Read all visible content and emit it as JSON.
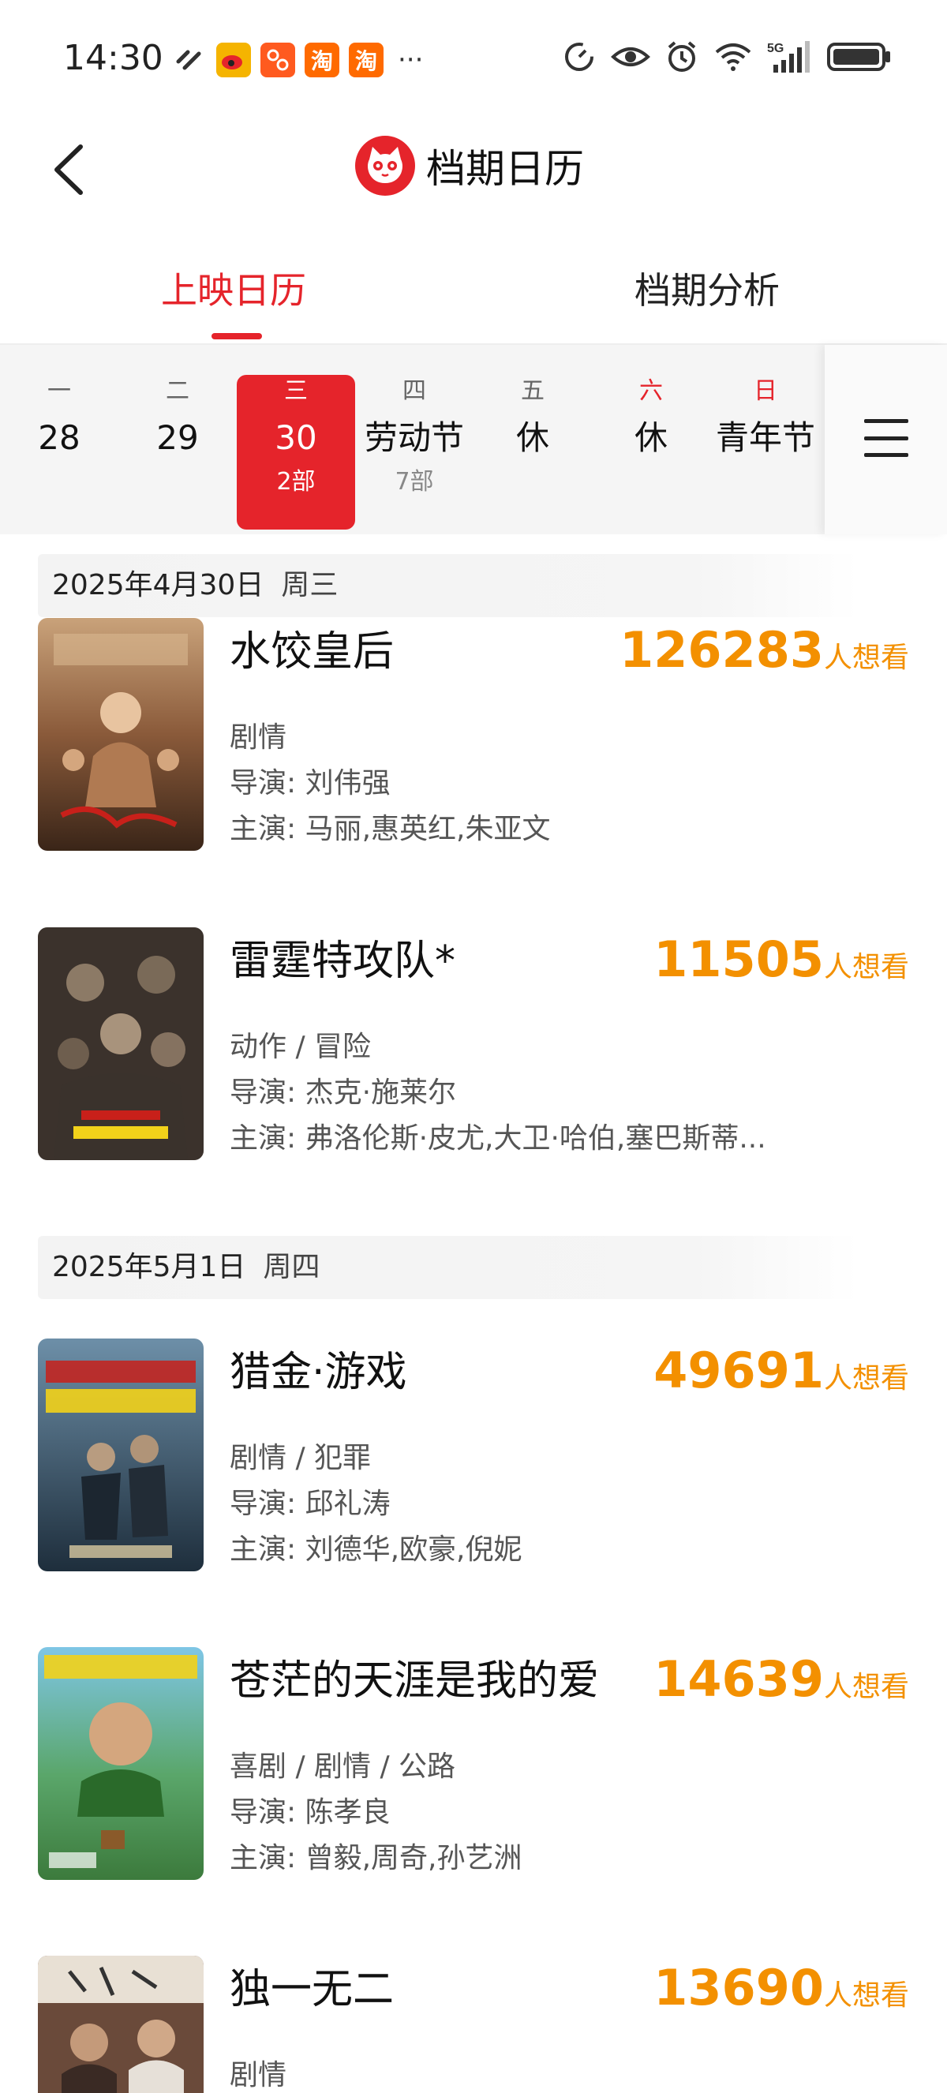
{
  "status_bar": {
    "time": "14:30",
    "left_icons": [
      "link-icon",
      "weibo-icon",
      "app-icon",
      "taobao-icon",
      "taobao-icon"
    ],
    "taobao_label": "淘",
    "overflow": "···",
    "right_icons": [
      "speed-icon",
      "eye-icon",
      "alarm-icon",
      "wifi-icon",
      "signal-5g-icon",
      "battery-icon"
    ],
    "network": "5G"
  },
  "header": {
    "title": "档期日历",
    "logo_icon": "maoyan-cat-icon",
    "back_icon": "back-arrow-icon"
  },
  "tabs": [
    {
      "label": "上映日历",
      "active": true
    },
    {
      "label": "档期分析",
      "active": false
    }
  ],
  "date_strip": {
    "days": [
      {
        "weekday": "一",
        "label": "28",
        "count": ""
      },
      {
        "weekday": "二",
        "label": "29",
        "count": ""
      },
      {
        "weekday": "三",
        "label": "30",
        "count": "2部",
        "selected": true
      },
      {
        "weekday": "四",
        "label": "劳动节",
        "count": "7部"
      },
      {
        "weekday": "五",
        "label": "休",
        "count": ""
      },
      {
        "weekday": "六",
        "label": "休",
        "count": "",
        "weekend": true
      },
      {
        "weekday": "日",
        "label": "青年节",
        "count": "",
        "weekend": true
      }
    ],
    "menu_icon": "menu-icon"
  },
  "sections": [
    {
      "date": "2025年4月30日",
      "weekday": "周三",
      "movies": [
        {
          "title": "水饺皇后",
          "want": "126283",
          "want_unit": "人想看",
          "genre": "剧情",
          "director": "导演: 刘伟强",
          "cast": "主演: 马丽,惠英红,朱亚文"
        },
        {
          "title": "雷霆特攻队*",
          "want": "11505",
          "want_unit": "人想看",
          "genre": "动作 / 冒险",
          "director": "导演: 杰克·施莱尔",
          "cast": "主演: 弗洛伦斯·皮尤,大卫·哈伯,塞巴斯蒂..."
        }
      ]
    },
    {
      "date": "2025年5月1日",
      "weekday": "周四",
      "movies": [
        {
          "title": "猎金·游戏",
          "want": "49691",
          "want_unit": "人想看",
          "genre": "剧情 / 犯罪",
          "director": "导演: 邱礼涛",
          "cast": "主演: 刘德华,欧豪,倪妮"
        },
        {
          "title": "苍茫的天涯是我的爱",
          "want": "14639",
          "want_unit": "人想看",
          "genre": "喜剧 / 剧情 / 公路",
          "director": "导演: 陈孝良",
          "cast": "主演: 曾毅,周奇,孙艺洲"
        },
        {
          "title": "独一无二",
          "want": "13690",
          "want_unit": "人想看",
          "genre": "剧情",
          "director": "",
          "cast": ""
        }
      ]
    }
  ],
  "colors": {
    "accent": "#e5242b",
    "want": "#f39000"
  }
}
